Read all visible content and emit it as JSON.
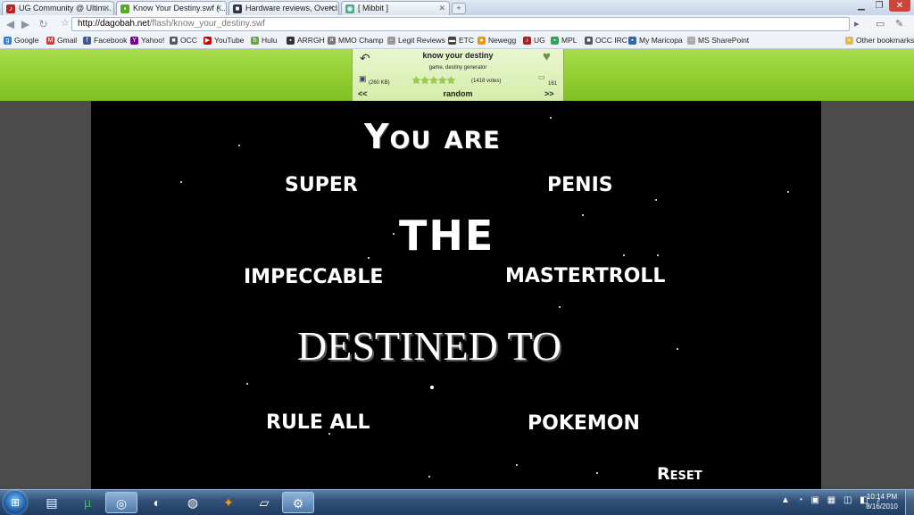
{
  "tabs": [
    {
      "label": "UG Community @ Ultim...",
      "icon": "guitar-icon",
      "active": false
    },
    {
      "label": "Know Your Destiny.swf (...",
      "icon": "green-page-icon",
      "active": true
    },
    {
      "label": "Hardware reviews, Overcl...",
      "icon": "occ-icon",
      "active": false
    },
    {
      "label": "[ Mibbit ]",
      "icon": "mibbit-icon",
      "active": false
    }
  ],
  "address": {
    "host": "http://dagobah.net",
    "path": "/flash/know_your_destiny.swf"
  },
  "bookmarks": [
    {
      "label": "Google",
      "color": "#3a7bd5"
    },
    {
      "label": "Gmail",
      "color": "#d33"
    },
    {
      "label": "Facebook",
      "color": "#3b5998"
    },
    {
      "label": "Yahoo!",
      "color": "#7b0099"
    },
    {
      "label": "OCC",
      "color": "#556"
    },
    {
      "label": "YouTube",
      "color": "#c00"
    },
    {
      "label": "Hulu",
      "color": "#6a3"
    },
    {
      "label": "ARRGH",
      "color": "#333"
    },
    {
      "label": "MMO Champ",
      "color": "#777"
    },
    {
      "label": "Legit Reviews",
      "color": "#999"
    },
    {
      "label": "ETC",
      "color": "#444"
    },
    {
      "label": "Newegg",
      "color": "#e90"
    },
    {
      "label": "UG",
      "color": "#a22"
    },
    {
      "label": "MPL",
      "color": "#2a5"
    },
    {
      "label": "OCC IRC",
      "color": "#556"
    },
    {
      "label": "My Maricopa",
      "color": "#36a"
    },
    {
      "label": "MS SharePoint",
      "color": "#aaa"
    }
  ],
  "other_bookmarks": "Other bookmarks",
  "game_info": {
    "title": "know your destiny",
    "tags": "game, destiny generator",
    "size": "(260 KB)",
    "votes": "(1418 votes)",
    "comments": "161",
    "prev": "<<",
    "random": "random",
    "next": ">>",
    "rating_stars": 5
  },
  "game": {
    "you_are": "You are",
    "the": "THE",
    "destined_to": "DESTINED TO",
    "reset": "Reset",
    "words": {
      "super": "SUPER",
      "penis": "PENIS",
      "impeccable": "IMPECCABLE",
      "mastertroll": "MASTERTROLL",
      "rule_all": "RULE ALL",
      "pokemon": "POKEMON"
    }
  },
  "taskbar": {
    "time": "10:14 PM",
    "date": "8/16/2010"
  }
}
